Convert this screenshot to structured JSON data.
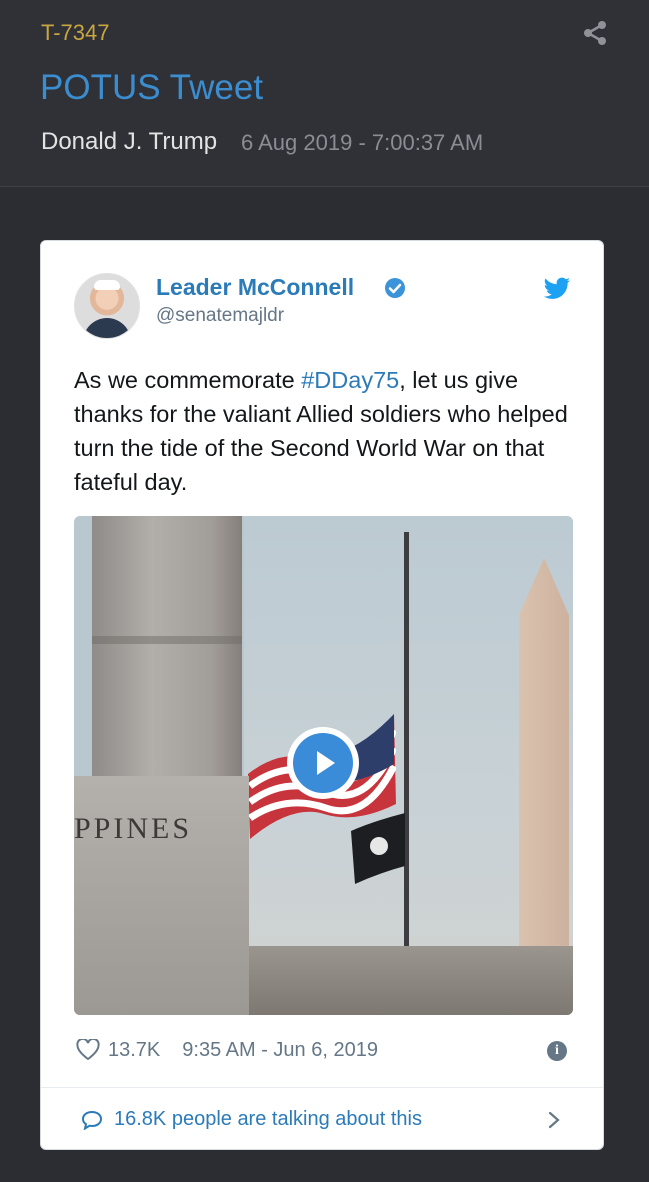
{
  "header": {
    "post_id": "T-7347",
    "title": "POTUS Tweet",
    "author": "Donald J. Trump",
    "date": "6 Aug 2019 - 7:00:37 AM",
    "share_icon": "share-icon"
  },
  "tweet": {
    "display_name": "Leader McConnell",
    "handle": "@senatemajldr",
    "text_before": "As we commemorate ",
    "hashtag": "#DDay75",
    "text_after": ", let us give thanks for the valiant Allied soldiers who helped turn the tide of the Second World War on that fateful day.",
    "media_caption_text": "PPINES",
    "likes": "13.7K",
    "timestamp": "9:35 AM - Jun 6, 2019",
    "talking": "16.8K people are talking about this"
  },
  "colors": {
    "background": "#2b2d33",
    "post_id": "#c9a640",
    "title": "#3b8dcf",
    "twitter_blue": "#2b7bb9"
  }
}
